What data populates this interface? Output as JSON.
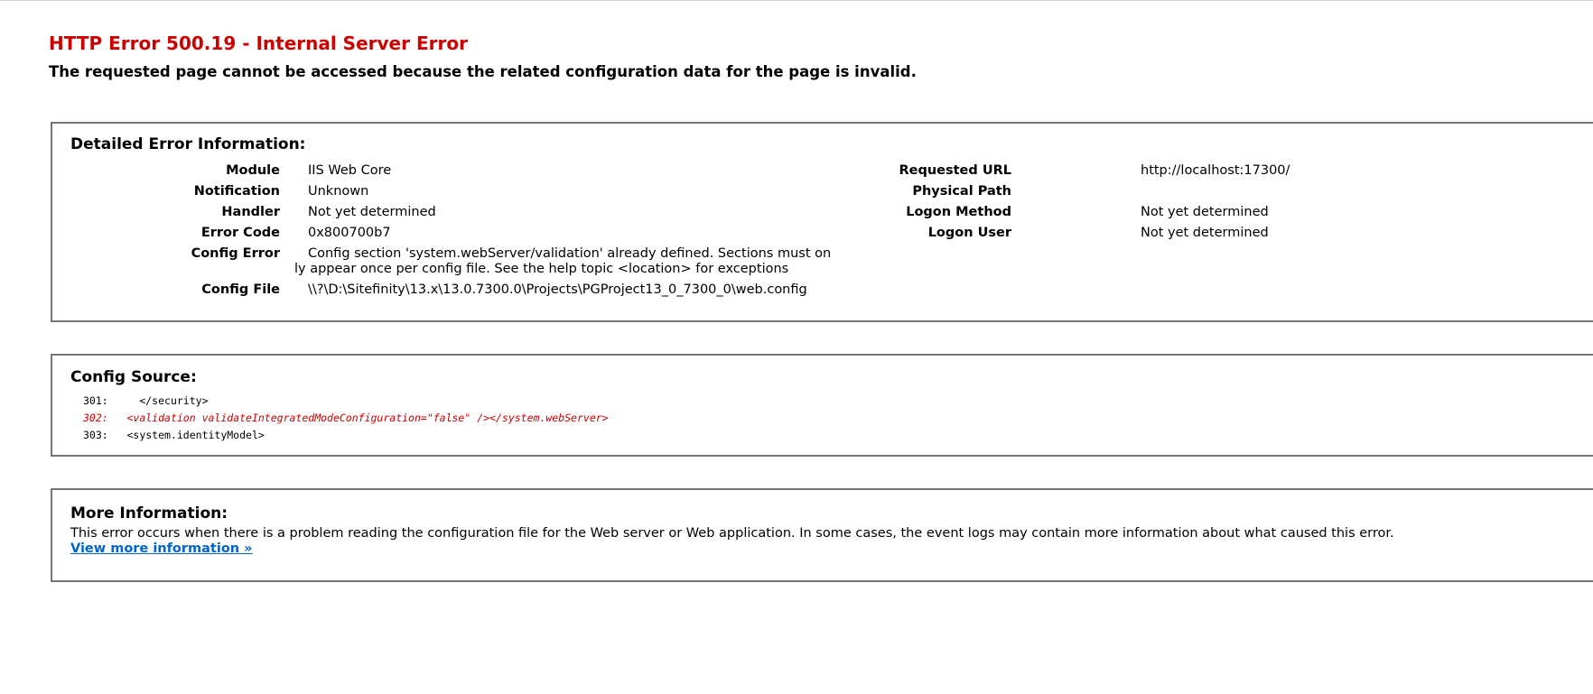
{
  "page": {
    "title": "HTTP Error 500.19 - Internal Server Error",
    "subtitle": "The requested page cannot be accessed because the related configuration data for the page is invalid."
  },
  "detail": {
    "heading": "Detailed Error Information:",
    "left": [
      {
        "key": "Module",
        "value": "IIS Web Core"
      },
      {
        "key": "Notification",
        "value": "Unknown"
      },
      {
        "key": "Handler",
        "value": "Not yet determined"
      },
      {
        "key": "Error Code",
        "value": "0x800700b7"
      },
      {
        "key": "Config Error",
        "value_line1": "Config section 'system.webServer/validation' already defined. Sections must on",
        "value_line2": "ly appear once per config file. See the help topic <location> for exceptions"
      },
      {
        "key": "Config File",
        "value": "\\\\?\\D:\\Sitefinity\\13.x\\13.0.7300.0\\Projects\\PGProject13_0_7300_0\\web.config"
      }
    ],
    "right": [
      {
        "key": "Requested URL",
        "value": "http://localhost:17300/"
      },
      {
        "key": "Physical Path",
        "value": ""
      },
      {
        "key": "Logon Method",
        "value": "Not yet determined"
      },
      {
        "key": "Logon User",
        "value": "Not yet determined"
      }
    ]
  },
  "source": {
    "heading": "Config Source:",
    "lines": [
      {
        "num": "301:",
        "code": "   </security>"
      },
      {
        "num": "302:",
        "code": " <validation validateIntegratedModeConfiguration=\"false\" /></system.webServer>"
      },
      {
        "num": "303:",
        "code": " <system.identityModel>"
      }
    ]
  },
  "more": {
    "heading": "More Information:",
    "text": "This error occurs when there is a problem reading the configuration file for the Web server or Web application. In some cases, the event logs may contain more information about what caused this error.",
    "link": "View more information »"
  },
  "colors": {
    "error_red": "#cc0000",
    "link_blue": "#0066cc",
    "box_border": "#757575"
  }
}
